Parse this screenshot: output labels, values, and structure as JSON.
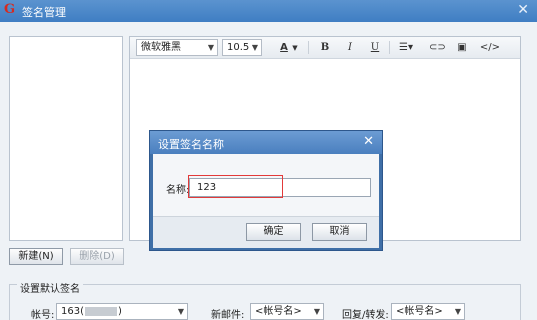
{
  "window": {
    "title": "签名管理"
  },
  "toolbar": {
    "font_family": "微软雅黑",
    "font_size": "10.5",
    "text_color_btn": "A",
    "bold": "B",
    "italic": "I",
    "underline": "U",
    "source_btn": "</>"
  },
  "buttons": {
    "new_label": "新建(N)",
    "delete_label": "删除(D)"
  },
  "default_sig": {
    "group_label": "设置默认签名",
    "account_label": "帐号:",
    "account_value": "163(",
    "account_value_end": ")",
    "new_mail_label": "新邮件:",
    "new_mail_value": "<帐号名>",
    "reply_label": "回复/转发:",
    "reply_value": "<帐号名>"
  },
  "dialog": {
    "title": "设置签名名称",
    "name_label": "名称:",
    "name_value": "123",
    "ok_label": "确定",
    "cancel_label": "取消"
  }
}
